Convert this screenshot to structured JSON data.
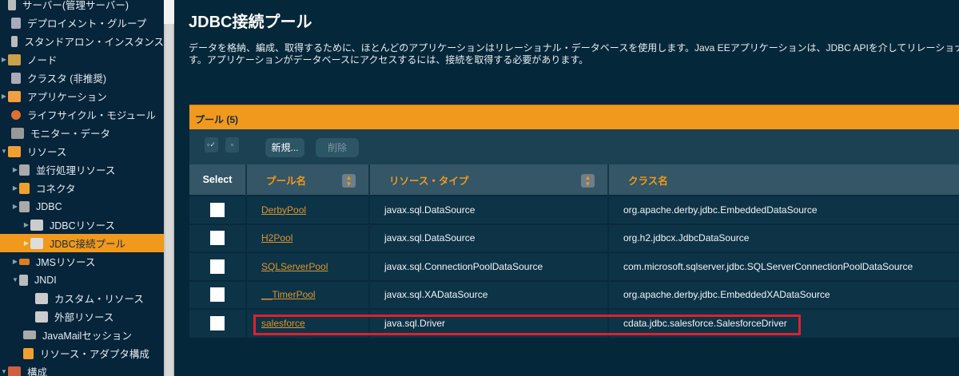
{
  "sidebar": {
    "items": [
      {
        "label": "サーバー(管理サーバー)"
      },
      {
        "label": "デプロイメント・グループ"
      },
      {
        "label": "スタンドアロン・インスタンス"
      },
      {
        "label": "ノード"
      },
      {
        "label": "クラスタ (非推奨)"
      },
      {
        "label": "アプリケーション"
      },
      {
        "label": "ライフサイクル・モジュール"
      },
      {
        "label": "モニター・データ"
      },
      {
        "label": "リソース"
      },
      {
        "label": "並行処理リソース"
      },
      {
        "label": "コネクタ"
      },
      {
        "label": "JDBC"
      },
      {
        "label": "JDBCリソース"
      },
      {
        "label": "JDBC接続プール"
      },
      {
        "label": "JMSリソース"
      },
      {
        "label": "JNDI"
      },
      {
        "label": "カスタム・リソース"
      },
      {
        "label": "外部リソース"
      },
      {
        "label": "JavaMailセッション"
      },
      {
        "label": "リソース・アダプタ構成"
      },
      {
        "label": "構成"
      }
    ]
  },
  "page": {
    "title": "JDBC接続プール",
    "desc1": "データを格納、編成、取得するために、ほとんどのアプリケーションはリレーショナル・データベースを使用します。Java EEアプリケーションは、JDBC APIを介してリレーショナル・",
    "desc2": "す。アプリケーションがデータベースにアクセスするには、接続を取得する必要があります。"
  },
  "table": {
    "title": "プール (5)",
    "new_label": "新規...",
    "delete_label": "削除",
    "select_all_icon": "選",
    "deselect_icon": "解",
    "headers": {
      "select": "Select",
      "name": "プール名",
      "type": "リソース・タイプ",
      "class": "クラス名"
    },
    "rows": [
      {
        "name": "DerbyPool",
        "type": "javax.sql.DataSource",
        "class": "org.apache.derby.jdbc.EmbeddedDataSource"
      },
      {
        "name": "H2Pool",
        "type": "javax.sql.DataSource",
        "class": "org.h2.jdbcx.JdbcDataSource"
      },
      {
        "name": "SQLServerPool",
        "type": "javax.sql.ConnectionPoolDataSource",
        "class": "com.microsoft.sqlserver.jdbc.SQLServerConnectionPoolDataSource"
      },
      {
        "name": "__TimerPool",
        "type": "javax.sql.XADataSource",
        "class": "org.apache.derby.jdbc.EmbeddedXADataSource"
      },
      {
        "name": "salesforce",
        "type": "java.sql.Driver",
        "class": "cdata.jdbc.salesforce.SalesforceDriver"
      }
    ]
  },
  "colors": {
    "accent": "#f0991c",
    "highlight": "#e0202a"
  }
}
